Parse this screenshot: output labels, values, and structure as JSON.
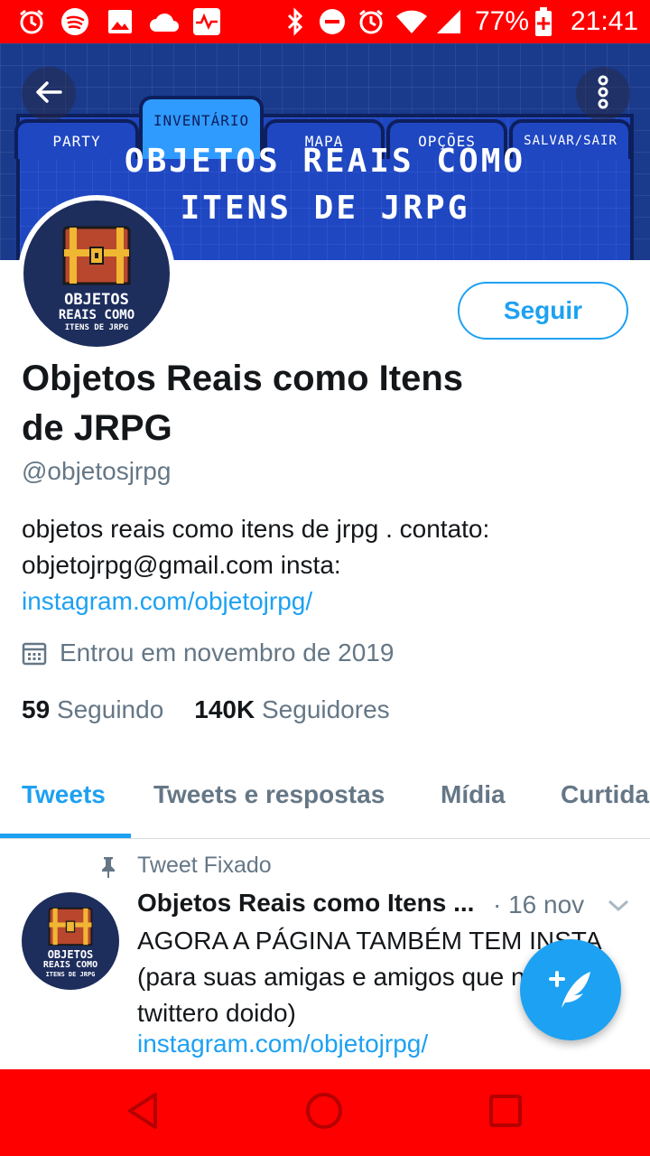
{
  "status_bar": {
    "battery": "77%",
    "time": "21:41",
    "icons": [
      "alarm-icon",
      "spotify-icon",
      "image-icon",
      "cloud-icon",
      "activity-icon",
      "bluetooth-icon",
      "dnd-icon",
      "alarm-icon",
      "wifi-icon",
      "signal-icon",
      "battery-icon"
    ]
  },
  "banner": {
    "tabs": [
      "PARTY",
      "INVENTÁRIO",
      "MAPA",
      "OPÇÕES",
      "SALVAR/SAIR"
    ],
    "active_tab": "INVENTÁRIO",
    "title_line1": "OBJETOS REAIS COMO",
    "title_line2": "ITENS DE JRPG"
  },
  "avatar": {
    "line1": "OBJETOS",
    "line2": "REAIS COMO",
    "line3": "ITENS DE JRPG"
  },
  "profile": {
    "follow_label": "Seguir",
    "name_line1": "Objetos Reais como Itens",
    "name_line2": "de JRPG",
    "handle": "@objetosjrpg",
    "bio_text": "objetos reais como itens de jrpg . contato: objetojrpg@gmail.com insta: ",
    "bio_link": "instagram.com/objetojrpg/",
    "joined": "Entrou em novembro de 2019",
    "following_count": "59",
    "following_label": "Seguindo",
    "followers_count": "140K",
    "followers_label": "Seguidores"
  },
  "tabs": [
    "Tweets",
    "Tweets e respostas",
    "Mídia",
    "Curtidas"
  ],
  "pinned_tweet": {
    "pin_label": "Tweet Fixado",
    "author": "Objetos Reais como Itens ...",
    "date": "· 16 nov",
    "text": "AGORA A PÁGINA TAMBÉM TEM INSTA (para suas amigas e amigos que não são twittero doido)",
    "link": "instagram.com/objetojrpg/"
  },
  "colors": {
    "accent": "#1da1f2",
    "system_bar": "#ff0000",
    "secondary_text": "#657786"
  }
}
